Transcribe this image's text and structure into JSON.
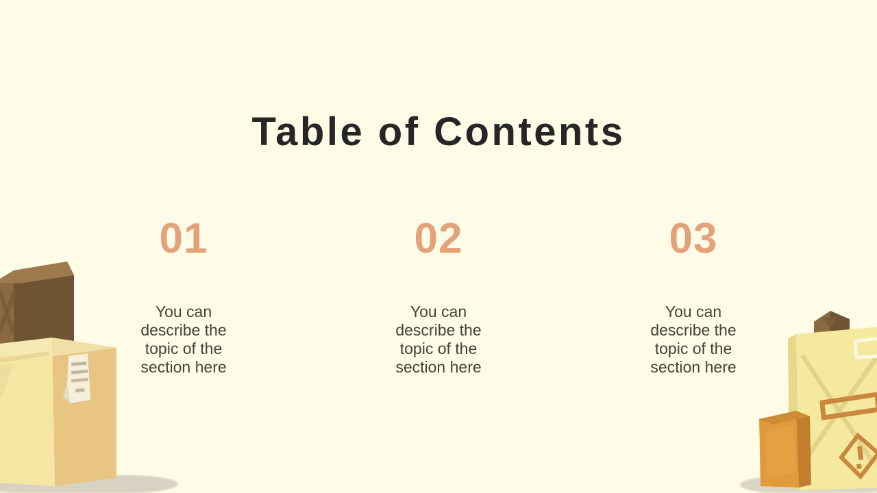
{
  "slide": {
    "background_color": "#fefbe7",
    "title": "Table of Contents",
    "title_color": "#262626",
    "number_color": "#e4a27a",
    "body_text_color": "#46423a"
  },
  "sections": [
    {
      "number": "01",
      "text": "You can describe the topic of the section here"
    },
    {
      "number": "02",
      "text": "You can describe the topic of the section here"
    },
    {
      "number": "03",
      "text": "You can describe the topic of the section here"
    }
  ],
  "decorations": {
    "left": {
      "name": "stacked-cardboard-boxes-illustration",
      "colors": {
        "brown_box_light": "#8b6a42",
        "brown_box_dark": "#6f5433",
        "brown_box_top": "#9e7a4e",
        "big_box_front": "#e8c582",
        "big_box_side": "#f5e6a3",
        "big_box_top": "#f7eab6",
        "label_paper": "#f5efdc",
        "label_lines": "#c0b89c",
        "warning_mark": "#d08a4a"
      }
    },
    "right": {
      "name": "tall-box-with-fragile-warning-illustration",
      "colors": {
        "tall_box_face": "#f5e9a0",
        "tall_box_side": "#e7d98c",
        "small_brown_box_light": "#8b6a42",
        "small_brown_box_dark": "#6f5433",
        "orange_box_front": "#e09a3c",
        "orange_box_side": "#c17e2e",
        "orange_box_top": "#cf8c35",
        "tape_line": "#e0d084",
        "warning_mark": "#c9873f",
        "label_paper": "#fdf8e0"
      }
    }
  }
}
